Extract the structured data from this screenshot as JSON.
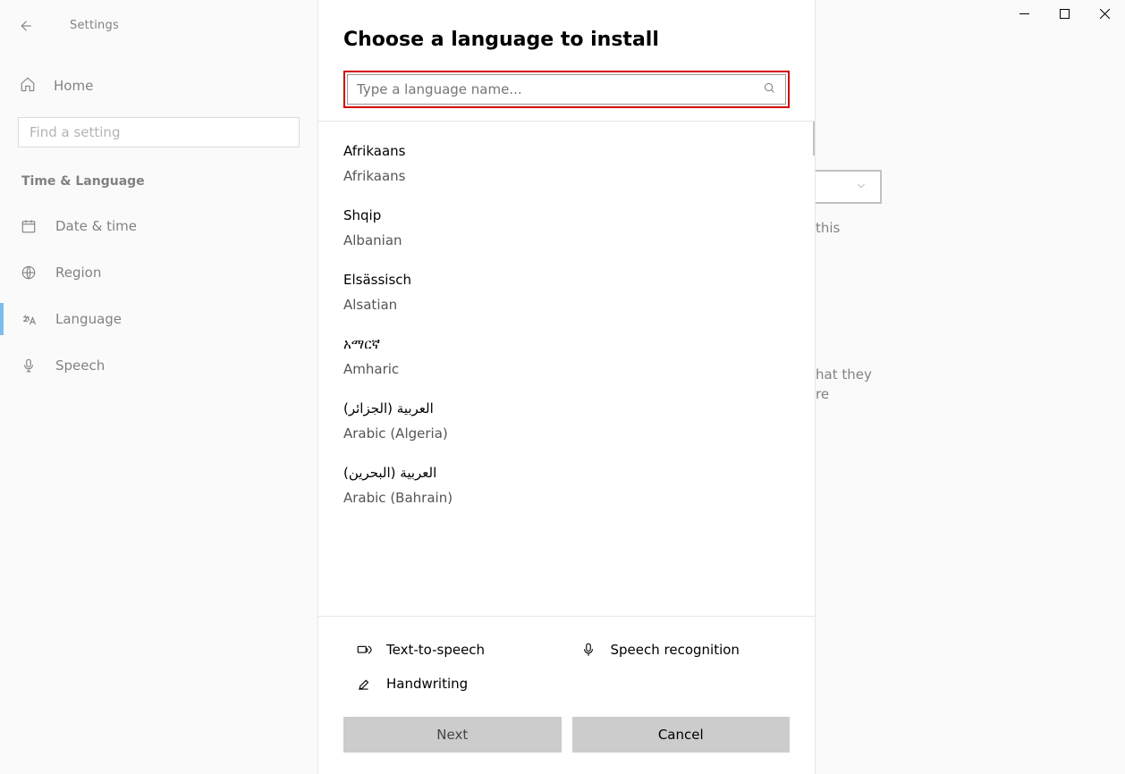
{
  "window": {
    "app_title": "Settings"
  },
  "sidebar": {
    "home_label": "Home",
    "find_placeholder": "Find a setting",
    "section_title": "Time & Language",
    "items": [
      {
        "label": "Date & time"
      },
      {
        "label": "Region"
      },
      {
        "label": "Language"
      },
      {
        "label": "Speech"
      }
    ]
  },
  "background_text": {
    "snippet1": "this",
    "snippet2a": "hat they",
    "snippet2b": "re"
  },
  "dialog": {
    "title": "Choose a language to install",
    "search_placeholder": "Type a language name...",
    "languages": [
      {
        "native": "Afrikaans",
        "english": "Afrikaans"
      },
      {
        "native": "Shqip",
        "english": "Albanian"
      },
      {
        "native": "Elsässisch",
        "english": "Alsatian"
      },
      {
        "native": "አማርኛ",
        "english": "Amharic"
      },
      {
        "native": "العربية (الجزائر)",
        "english": "Arabic (Algeria)"
      },
      {
        "native": "العربية (البحرين)",
        "english": "Arabic (Bahrain)"
      }
    ],
    "features": {
      "tts": "Text-to-speech",
      "speech": "Speech recognition",
      "handwriting": "Handwriting"
    },
    "buttons": {
      "next": "Next",
      "cancel": "Cancel"
    }
  }
}
